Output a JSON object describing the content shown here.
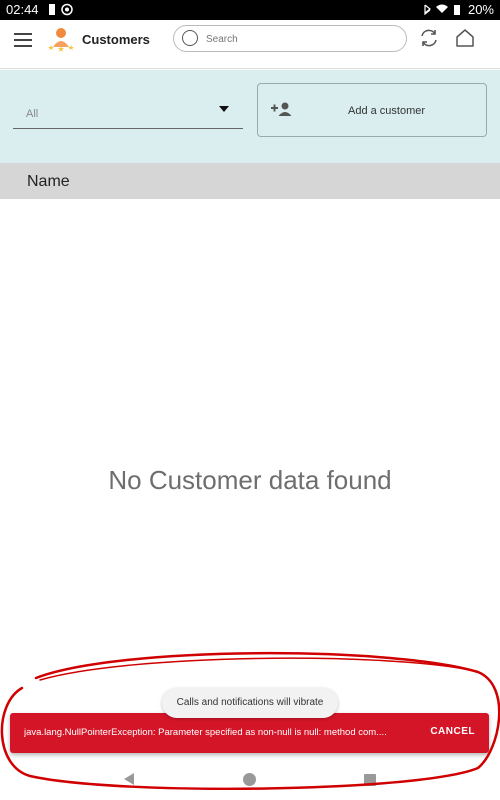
{
  "status_bar": {
    "time": "02:44",
    "battery": "20%"
  },
  "app_bar": {
    "title": "Customers",
    "search_placeholder": "Search"
  },
  "filter": {
    "selected": "All",
    "add_button_label": "Add a customer"
  },
  "table": {
    "columns": [
      "Name"
    ]
  },
  "empty_state": {
    "message": "No Customer data found"
  },
  "toast": {
    "text": "Calls and notifications will vibrate"
  },
  "error_snackbar": {
    "text": "java.lang.NullPointerException: Parameter specified as non-null is null: method com....",
    "action_label": "CANCEL",
    "color": "#d41528"
  },
  "colors": {
    "filter_panel": "#daeef0",
    "header_row": "#d6d6d6",
    "annotation": "#d00000"
  }
}
